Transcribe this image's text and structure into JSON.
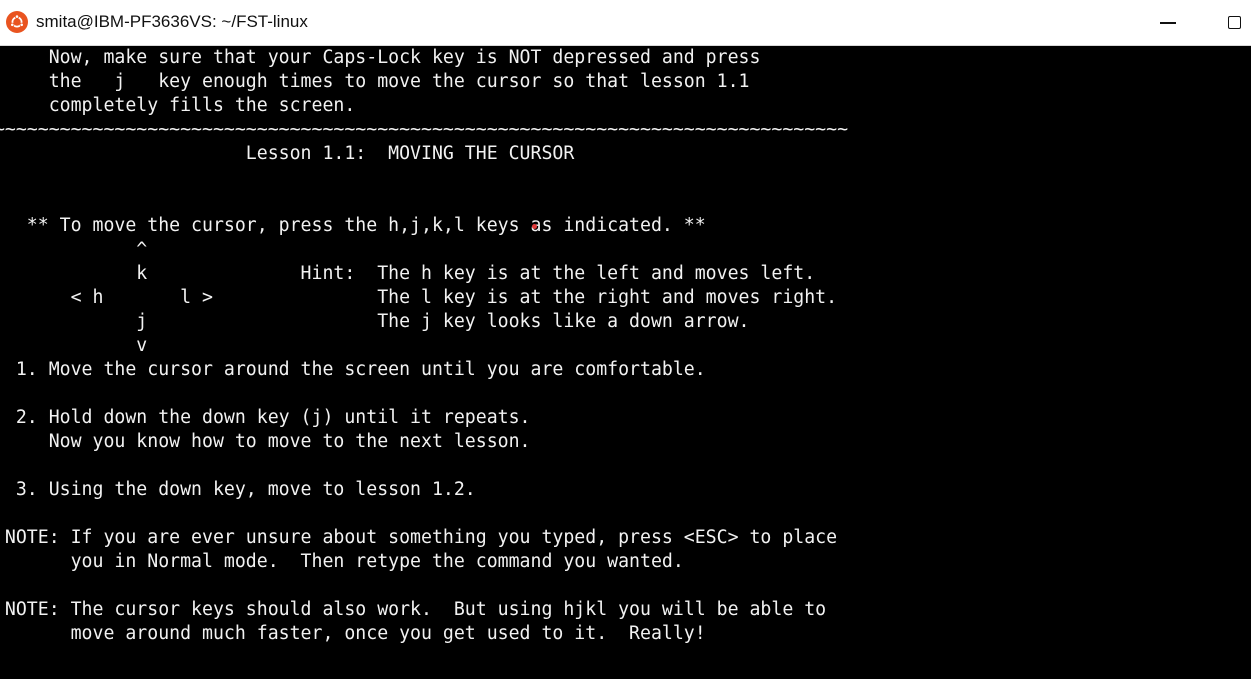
{
  "window": {
    "title": "smita@IBM-PF3636VS: ~/FST-linux",
    "icon": "ubuntu-icon",
    "controls": [
      "minimize-icon",
      "maximize-icon"
    ]
  },
  "terminal": {
    "lines": [
      "      Now, make sure that your Caps-Lock key is NOT depressed and press",
      "      the   j   key enough times to move the cursor so that lesson 1.1",
      "      completely fills the screen.",
      "~~~~~~~~~~~~~~~~~~~~~~~~~~~~~~~~~~~~~~~~~~~~~~~~~~~~~~~~~~~~~~~~~~~~~~~~~~~~~~~",
      "                        Lesson 1.1:  MOVING THE CURSOR",
      "",
      "",
      "    ** To move the cursor, press the h,j,k,l keys as indicated. **",
      "              ^",
      "              k              Hint:  The h key is at the left and moves left.",
      "        < h       l >               The l key is at the right and moves right.",
      "              j                     The j key looks like a down arrow.",
      "              v",
      "   1. Move the cursor around the screen until you are comfortable.",
      "",
      "   2. Hold down the down key (j) until it repeats.",
      "      Now you know how to move to the next lesson.",
      "",
      "   3. Using the down key, move to lesson 1.2.",
      "",
      "  NOTE: If you are ever unsure about something you typed, press <ESC> to place",
      "        you in Normal mode.  Then retype the command you wanted.",
      "",
      "  NOTE: The cursor keys should also work.  But using hjkl you will be able to",
      "        move around much faster, once you get used to it.  Really!"
    ]
  }
}
